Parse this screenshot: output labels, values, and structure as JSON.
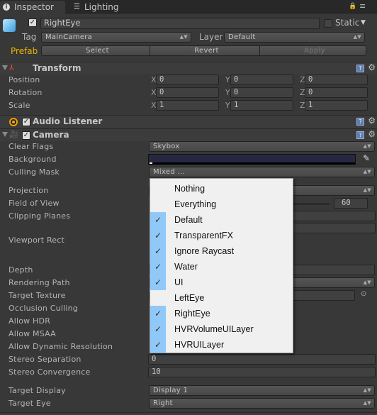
{
  "tabs": [
    {
      "label": "Inspector",
      "icon": "info-icon"
    },
    {
      "label": "Lighting",
      "icon": "sliders-icon"
    }
  ],
  "object": {
    "name": "RightEye",
    "active": true,
    "static_label": "Static",
    "static": false,
    "tag_label": "Tag",
    "tag": "MainCamera",
    "layer_label": "Layer",
    "layer": "Default",
    "prefab_label": "Prefab",
    "select": "Select",
    "revert": "Revert",
    "apply": "Apply"
  },
  "transform": {
    "title": "Transform",
    "rows": [
      {
        "label": "Position",
        "x": "0",
        "y": "0",
        "z": "0"
      },
      {
        "label": "Rotation",
        "x": "0",
        "y": "0",
        "z": "0"
      },
      {
        "label": "Scale",
        "x": "1",
        "y": "1",
        "z": "1"
      }
    ],
    "axes": [
      "X",
      "Y",
      "Z"
    ]
  },
  "audio_listener": {
    "title": "Audio Listener",
    "enabled": true
  },
  "camera": {
    "title": "Camera",
    "enabled": true,
    "labels": {
      "clear_flags": "Clear Flags",
      "background": "Background",
      "culling_mask": "Culling Mask",
      "projection": "Projection",
      "fov": "Field of View",
      "clipping": "Clipping Planes",
      "viewport": "Viewport Rect",
      "depth": "Depth",
      "rendering_path": "Rendering Path",
      "target_texture": "Target Texture",
      "occlusion": "Occlusion Culling",
      "hdr": "Allow HDR",
      "msaa": "Allow MSAA",
      "dynres": "Allow Dynamic Resolution",
      "stereo_sep": "Stereo Separation",
      "stereo_conv": "Stereo Convergence",
      "target_display": "Target Display",
      "target_eye": "Target Eye"
    },
    "clear_flags": "Skybox",
    "background_color": "#262840",
    "culling_mask": "Mixed ...",
    "fov": "60",
    "stereo_sep": "0",
    "stereo_conv": "10",
    "target_display": "Display 1",
    "target_eye": "Right"
  },
  "culling_menu": {
    "items": [
      {
        "label": "Nothing",
        "checked": false
      },
      {
        "label": "Everything",
        "checked": false
      },
      {
        "label": "Default",
        "checked": true
      },
      {
        "label": "TransparentFX",
        "checked": true
      },
      {
        "label": "Ignore Raycast",
        "checked": true
      },
      {
        "label": "Water",
        "checked": true
      },
      {
        "label": "UI",
        "checked": true
      },
      {
        "label": "LeftEye",
        "checked": false
      },
      {
        "label": "RightEye",
        "checked": true
      },
      {
        "label": "HVRVolumeUILayer",
        "checked": true
      },
      {
        "label": "HVRUILayer",
        "checked": true
      }
    ]
  },
  "colors": {
    "background": "#383838",
    "prefab": "#f0b400",
    "check_highlight": "#90c8f8"
  }
}
